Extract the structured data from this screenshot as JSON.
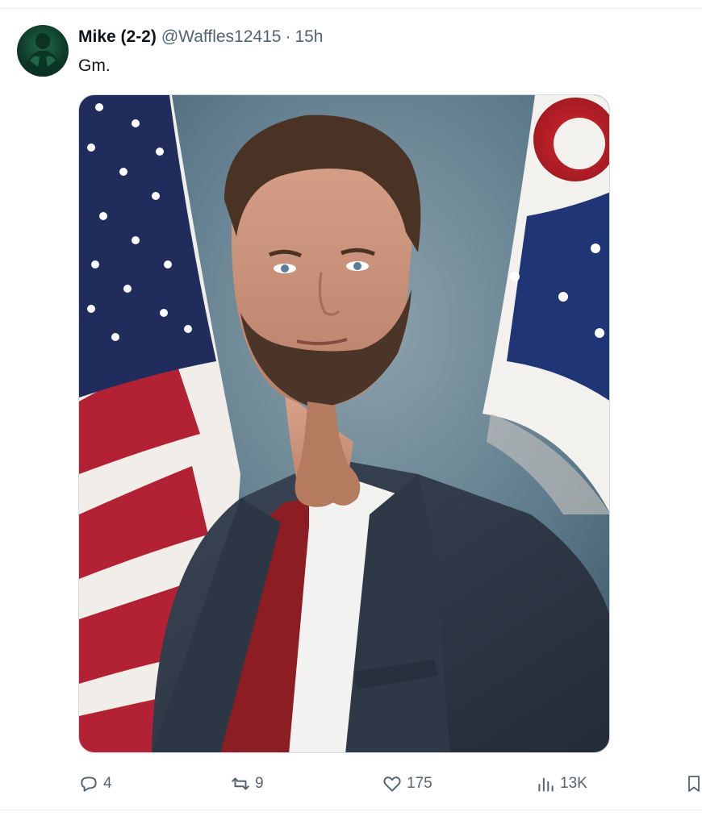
{
  "tweet": {
    "author": {
      "display_name": "Mike (2-2)",
      "handle": "@Waffles12415",
      "avatar_icon": "avatar-image"
    },
    "separator": "·",
    "time": "15h",
    "text": "Gm.",
    "media": {
      "type": "photo",
      "icon": "photo-portrait-image"
    }
  },
  "actions": {
    "reply": {
      "icon": "reply-icon",
      "count": "4"
    },
    "retweet": {
      "icon": "retweet-icon",
      "count": "9"
    },
    "like": {
      "icon": "heart-icon",
      "count": "175"
    },
    "views": {
      "icon": "views-chart-icon",
      "count": "13K"
    },
    "bookmark": {
      "icon": "bookmark-icon"
    }
  },
  "colors": {
    "text_primary": "#0f1419",
    "text_secondary": "#536471",
    "divider": "#eff3f4"
  }
}
